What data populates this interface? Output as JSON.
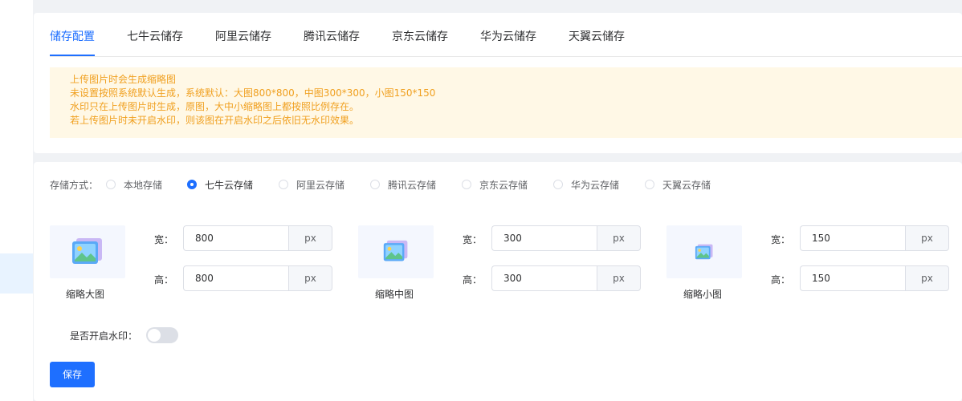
{
  "tabs": [
    "储存配置",
    "七牛云储存",
    "阿里云储存",
    "腾讯云储存",
    "京东云储存",
    "华为云储存",
    "天翼云储存"
  ],
  "active_tab": 0,
  "notice": [
    "上传图片时会生成缩略图",
    "未设置按照系统默认生成，系统默认：大图800*800，中图300*300，小图150*150",
    "水印只在上传图片时生成，原图，大中小缩略图上都按照比例存在。",
    "若上传图片时未开启水印，则该图在开启水印之后依旧无水印效果。"
  ],
  "storage": {
    "label": "存储方式：",
    "options": [
      "本地存储",
      "七牛云存储",
      "阿里云存储",
      "腾讯云存储",
      "京东云存储",
      "华为云存储",
      "天翼云存储"
    ],
    "selected": 1
  },
  "thumbs": [
    {
      "label": "缩略大图",
      "width_label": "宽：",
      "height_label": "高：",
      "width": "800",
      "height": "800",
      "unit": "px"
    },
    {
      "label": "缩略中图",
      "width_label": "宽：",
      "height_label": "高：",
      "width": "300",
      "height": "300",
      "unit": "px"
    },
    {
      "label": "缩略小图",
      "width_label": "宽：",
      "height_label": "高：",
      "width": "150",
      "height": "150",
      "unit": "px"
    }
  ],
  "watermark": {
    "label": "是否开启水印：",
    "enabled": false
  },
  "save_label": "保存",
  "colors": {
    "primary": "#1e6fff",
    "warning_text": "#f0a020",
    "warning_bg": "#fff8e6"
  }
}
